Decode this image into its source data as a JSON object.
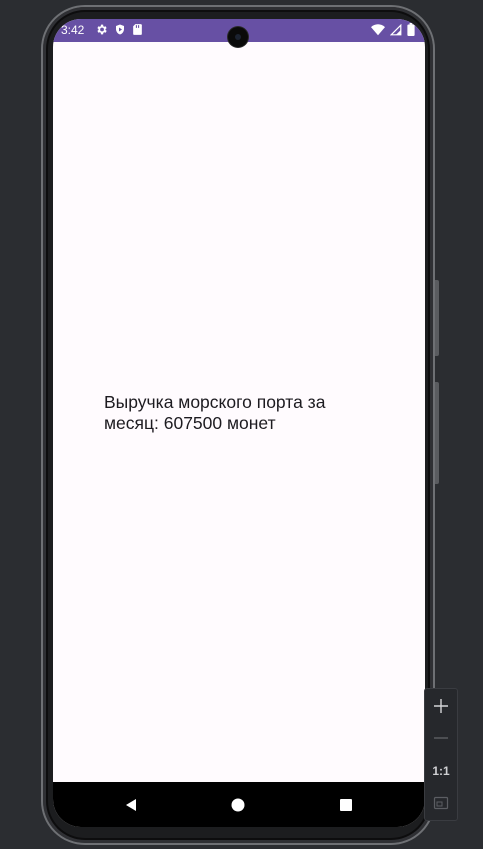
{
  "status_bar": {
    "time": "3:42",
    "left_icons": [
      "settings-icon",
      "shield-icon",
      "sd-card-icon"
    ],
    "right_icons": [
      "wifi-icon",
      "signal-icon",
      "battery-icon"
    ],
    "color": "#6750a4"
  },
  "screen": {
    "background": "#fffbfe",
    "text": "Выручка морского порта за месяц: 607500 монет"
  },
  "nav_bar": {
    "buttons": [
      "back-icon",
      "home-icon",
      "recents-icon"
    ]
  },
  "zoom_toolbar": {
    "zoom_in_icon": "plus-icon",
    "zoom_out_icon": "minus-icon",
    "actual_size_label": "1:1",
    "fit_icon": "fit-screen-icon"
  }
}
